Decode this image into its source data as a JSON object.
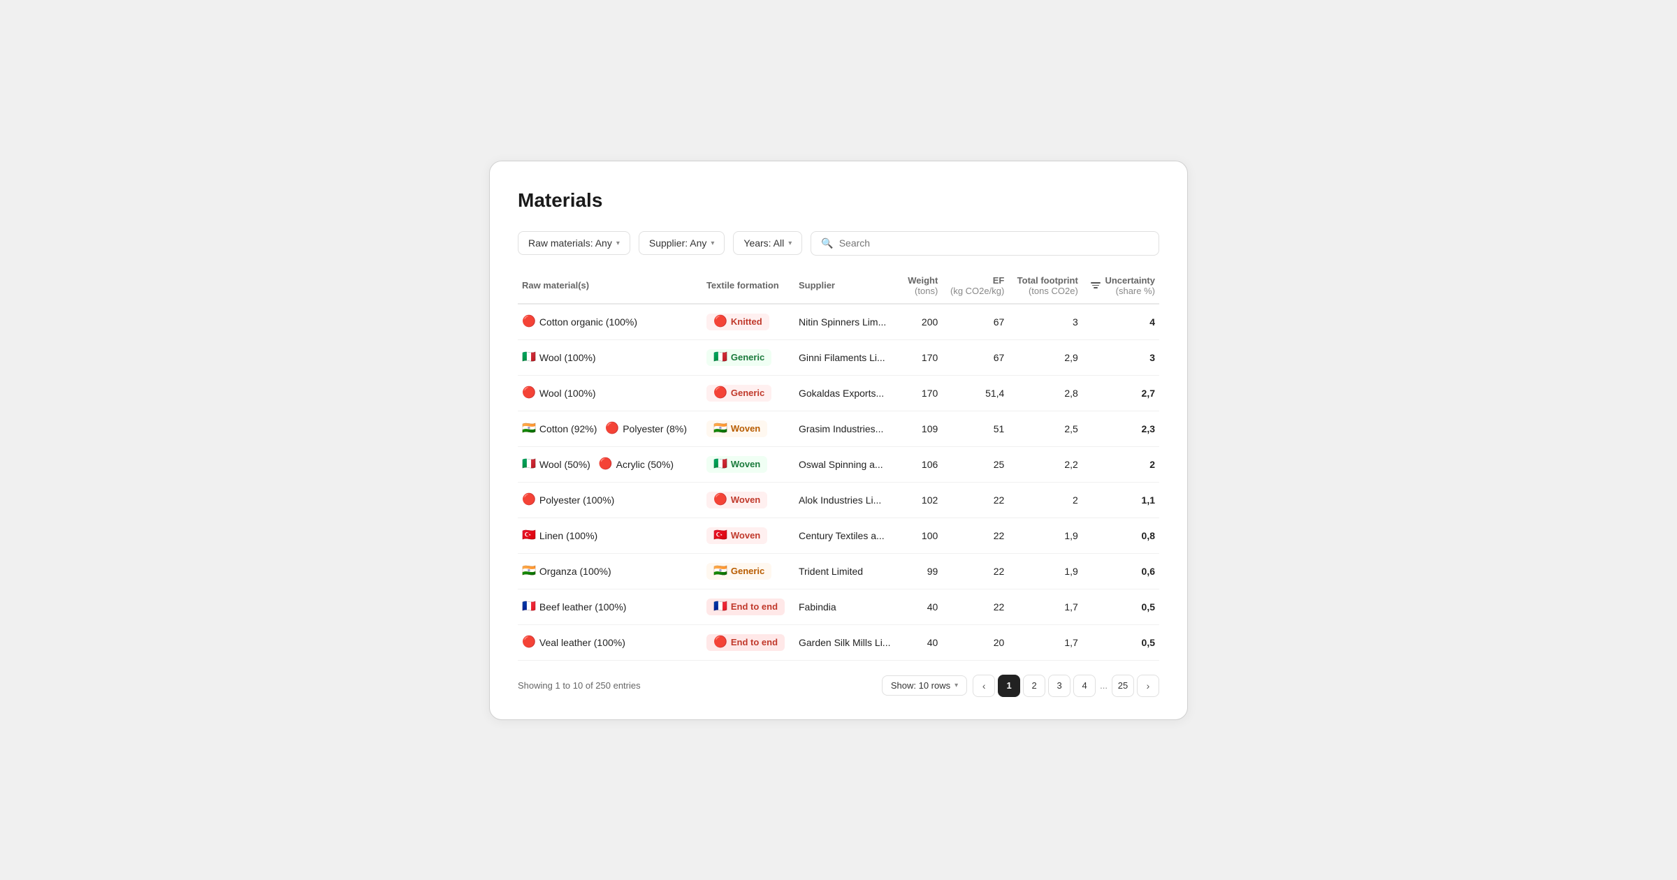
{
  "page": {
    "title": "Materials"
  },
  "toolbar": {
    "filter_raw": "Raw materials: Any",
    "filter_supplier": "Supplier: Any",
    "filter_years": "Years: All",
    "search_placeholder": "Search"
  },
  "table": {
    "headers": [
      {
        "id": "raw_materials",
        "label": "Raw material(s)",
        "align": "left"
      },
      {
        "id": "textile_formation",
        "label": "Textile formation",
        "align": "left"
      },
      {
        "id": "supplier",
        "label": "Supplier",
        "align": "left"
      },
      {
        "id": "weight",
        "label": "Weight",
        "sublabel": "(tons)",
        "align": "right"
      },
      {
        "id": "ef",
        "label": "EF",
        "sublabel": "(kg CO2e/kg)",
        "align": "right"
      },
      {
        "id": "total_footprint",
        "label": "Total footprint",
        "sublabel": "(tons CO2e)",
        "align": "right"
      },
      {
        "id": "uncertainty",
        "label": "Uncertainty",
        "sublabel": "(share %)",
        "align": "right"
      }
    ],
    "rows": [
      {
        "raw_materials": "Cotton organic (100%)",
        "raw_flag": "🔴",
        "textile_formation": "Knitted",
        "textile_flag": "🔴",
        "textile_style": "red",
        "supplier": "Nitin Spinners Lim...",
        "weight": "200",
        "ef": "67",
        "total_footprint": "3",
        "uncertainty": "4"
      },
      {
        "raw_materials": "Wool (100%)",
        "raw_flag": "🇮🇹",
        "textile_formation": "Generic",
        "textile_flag": "🇮🇹",
        "textile_style": "green",
        "supplier": "Ginni Filaments Li...",
        "weight": "170",
        "ef": "67",
        "total_footprint": "2,9",
        "uncertainty": "3"
      },
      {
        "raw_materials": "Wool (100%)",
        "raw_flag": "🔴",
        "textile_formation": "Generic",
        "textile_flag": "🔴",
        "textile_style": "red",
        "supplier": "Gokaldas Exports...",
        "weight": "170",
        "ef": "51,4",
        "total_footprint": "2,8",
        "uncertainty": "2,7"
      },
      {
        "raw_materials": "Cotton (92%)  Polyester (8%)",
        "raw_flag": "🇮🇳",
        "raw_flag2": "🔴",
        "textile_formation": "Woven",
        "textile_flag": "🇮🇳",
        "textile_style": "orange",
        "supplier": "Grasim Industries...",
        "weight": "109",
        "ef": "51",
        "total_footprint": "2,5",
        "uncertainty": "2,3"
      },
      {
        "raw_materials": "Wool (50%)  Acrylic (50%)",
        "raw_flag": "🇮🇹",
        "raw_flag2": "🔴",
        "textile_formation": "Woven",
        "textile_flag": "🇮🇹",
        "textile_style": "green",
        "supplier": "Oswal Spinning a...",
        "weight": "106",
        "ef": "25",
        "total_footprint": "2,2",
        "uncertainty": "2"
      },
      {
        "raw_materials": "Polyester (100%)",
        "raw_flag": "🔴",
        "textile_formation": "Woven",
        "textile_flag": "🔴",
        "textile_style": "red",
        "supplier": "Alok Industries Li...",
        "weight": "102",
        "ef": "22",
        "total_footprint": "2",
        "uncertainty": "1,1"
      },
      {
        "raw_materials": "Linen (100%)",
        "raw_flag": "🇹🇷",
        "textile_formation": "Woven",
        "textile_flag": "🇹🇷",
        "textile_style": "red",
        "supplier": "Century Textiles a...",
        "weight": "100",
        "ef": "22",
        "total_footprint": "1,9",
        "uncertainty": "0,8"
      },
      {
        "raw_materials": "Organza (100%)",
        "raw_flag": "🇮🇳",
        "textile_formation": "Generic",
        "textile_flag": "🇮🇳",
        "textile_style": "orange",
        "supplier": "Trident Limited",
        "weight": "99",
        "ef": "22",
        "total_footprint": "1,9",
        "uncertainty": "0,6"
      },
      {
        "raw_materials": "Beef leather (100%)",
        "raw_flag": "🇫🇷",
        "textile_formation": "End to end",
        "textile_flag": "🇫🇷",
        "textile_style": "end2end",
        "supplier": "Fabindia",
        "weight": "40",
        "ef": "22",
        "total_footprint": "1,7",
        "uncertainty": "0,5"
      },
      {
        "raw_materials": "Veal leather (100%)",
        "raw_flag": "🔴",
        "textile_formation": "End to end",
        "textile_flag": "🔴",
        "textile_style": "end2end",
        "supplier": "Garden Silk Mills Li...",
        "weight": "40",
        "ef": "20",
        "total_footprint": "1,7",
        "uncertainty": "0,5"
      }
    ]
  },
  "pagination": {
    "showing_text": "Showing 1 to 10 of 250 entries",
    "show_rows_label": "Show: 10 rows",
    "pages": [
      "1",
      "2",
      "3",
      "4",
      "...",
      "25"
    ],
    "current_page": "1",
    "prev_arrow": "‹",
    "next_arrow": "›"
  }
}
